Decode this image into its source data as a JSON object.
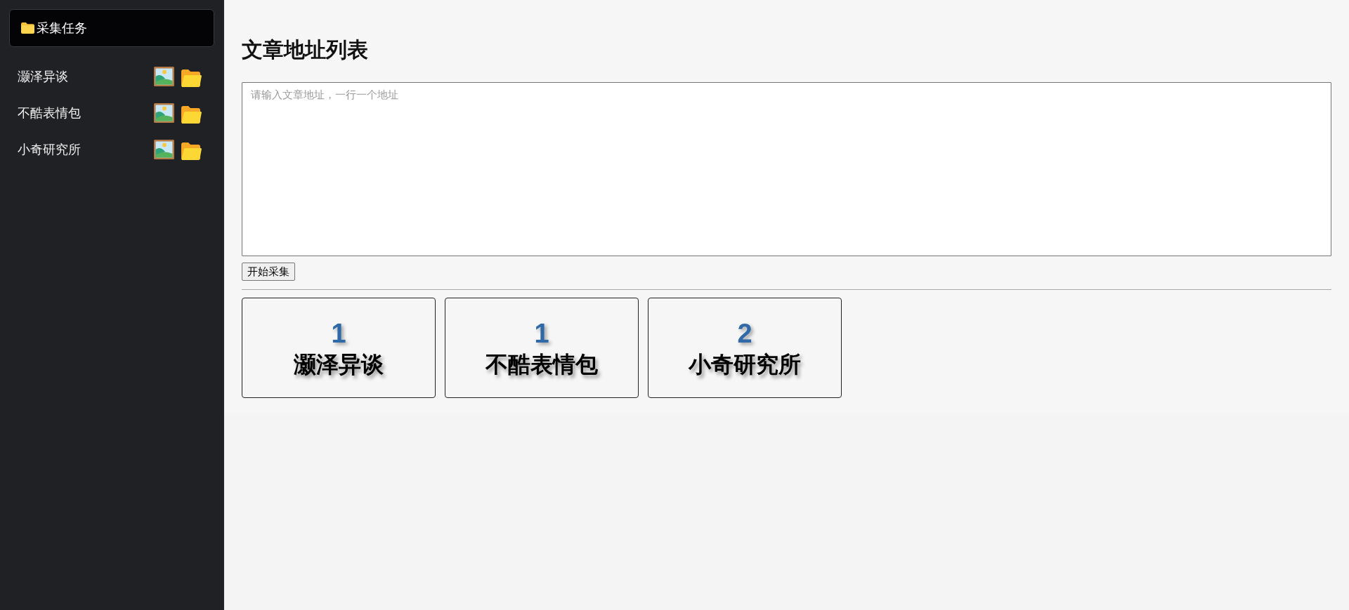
{
  "sidebar": {
    "header": {
      "title": "采集任务"
    },
    "items": [
      {
        "name": "灏泽异谈"
      },
      {
        "name": "不酷表情包"
      },
      {
        "name": "小奇研究所"
      }
    ]
  },
  "main": {
    "title": "文章地址列表",
    "url_input": {
      "placeholder": "请输入文章地址，一行一个地址"
    },
    "start_button": "开始采集",
    "cards": [
      {
        "count": "1",
        "name": "灏泽异谈"
      },
      {
        "count": "1",
        "name": "不酷表情包"
      },
      {
        "count": "2",
        "name": "小奇研究所"
      }
    ]
  }
}
